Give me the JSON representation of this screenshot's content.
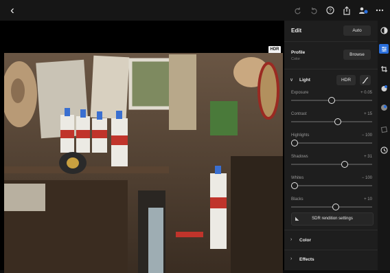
{
  "topbar": {
    "back_icon": "chevron-left-icon",
    "icons": [
      "redo-icon",
      "undo-icon",
      "help-icon",
      "share-icon",
      "people-icon",
      "more-icon"
    ]
  },
  "canvas": {
    "hdr_badge": "HDR"
  },
  "panel": {
    "edit_title": "Edit",
    "auto_label": "Auto",
    "profile_label": "Profile",
    "profile_value": "Color",
    "browse_label": "Browse",
    "light_label": "Light",
    "hdr_label": "HDR",
    "sliders": [
      {
        "label": "Exposure",
        "value": "+ 0.05",
        "position": 0.5
      },
      {
        "label": "Contrast",
        "value": "+ 15",
        "position": 0.58
      },
      {
        "label": "Highlights",
        "value": "− 100",
        "position": 0.0
      },
      {
        "label": "Shadows",
        "value": "+ 31",
        "position": 0.66
      },
      {
        "label": "Whites",
        "value": "− 100",
        "position": 0.0
      },
      {
        "label": "Blacks",
        "value": "+ 10",
        "position": 0.55
      }
    ],
    "sdr_label": "SDR rendition settings",
    "sections": [
      {
        "label": "Color"
      },
      {
        "label": "Effects"
      }
    ]
  },
  "rail": {
    "icons": [
      "presets-icon",
      "edit-sliders-icon",
      "crop-icon",
      "masking-icon",
      "healing-icon",
      "versions-icon",
      "history-icon"
    ]
  }
}
